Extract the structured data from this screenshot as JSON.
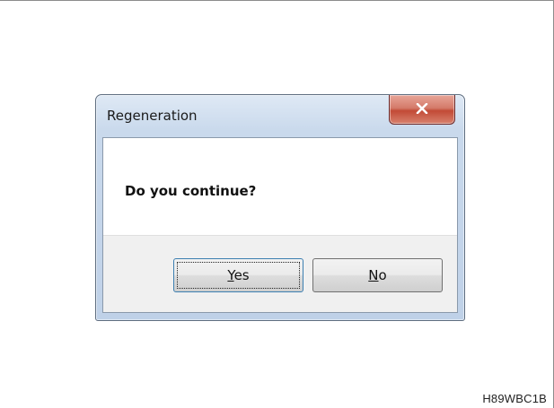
{
  "dialog": {
    "title": "Regeneration",
    "message": "Do you continue?",
    "close_icon": "close-icon",
    "buttons": {
      "yes": {
        "mnemonic": "Y",
        "rest": "es",
        "default": true
      },
      "no": {
        "mnemonic": "N",
        "rest": "o",
        "default": false
      }
    }
  },
  "figure_code": "H89WBC1B",
  "colors": {
    "close_button": "#c9503c",
    "frame": "#bfd1e8",
    "button_area": "#f0f0f0"
  }
}
